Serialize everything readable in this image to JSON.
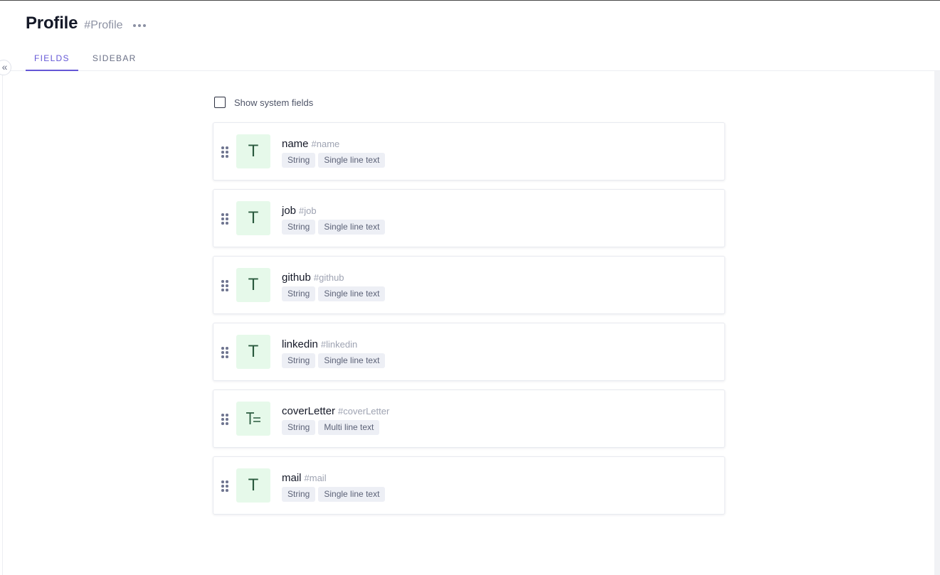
{
  "header": {
    "title": "Profile",
    "hash": "#Profile",
    "tabs": [
      {
        "label": "FIELDS",
        "active": true
      },
      {
        "label": "SIDEBAR",
        "active": false
      }
    ]
  },
  "content": {
    "show_system_fields_label": "Show system fields",
    "show_system_fields_checked": false,
    "fields": [
      {
        "name": "name",
        "hash": "#name",
        "type_tag": "String",
        "editor_tag": "Single line text",
        "icon": "text-icon"
      },
      {
        "name": "job",
        "hash": "#job",
        "type_tag": "String",
        "editor_tag": "Single line text",
        "icon": "text-icon"
      },
      {
        "name": "github",
        "hash": "#github",
        "type_tag": "String",
        "editor_tag": "Single line text",
        "icon": "text-icon"
      },
      {
        "name": "linkedin",
        "hash": "#linkedin",
        "type_tag": "String",
        "editor_tag": "Single line text",
        "icon": "text-icon"
      },
      {
        "name": "coverLetter",
        "hash": "#coverLetter",
        "type_tag": "String",
        "editor_tag": "Multi line text",
        "icon": "multiline-text-icon"
      },
      {
        "name": "mail",
        "hash": "#mail",
        "type_tag": "String",
        "editor_tag": "Single line text",
        "icon": "text-icon"
      }
    ]
  },
  "colors": {
    "accent": "#6457d6",
    "icon_bg": "#e6f9ea",
    "icon_fg": "#2a5a3e",
    "tag_bg": "#edeff5"
  }
}
